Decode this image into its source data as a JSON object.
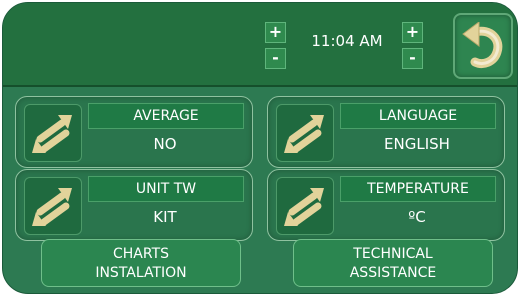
{
  "header": {
    "time": "11:04 AM",
    "hour_increase": "+",
    "hour_decrease": "-",
    "minute_increase": "+",
    "minute_decrease": "-"
  },
  "settings": [
    {
      "label": "AVERAGE",
      "value": "NO"
    },
    {
      "label": "LANGUAGE",
      "value": "ENGLISH"
    },
    {
      "label": "UNIT TW",
      "value": "KIT"
    },
    {
      "label": "TEMPERATURE",
      "value": "ºC"
    }
  ],
  "buttons": {
    "charts_line1": "CHARTS",
    "charts_line2": "INSTALATION",
    "tech_line1": "TECHNICAL",
    "tech_line2": "ASSISTANCE"
  },
  "icons": {
    "swap": "swap-arrows-icon",
    "back": "back-arrow-icon"
  },
  "colors": {
    "panel": "#2d7a52",
    "header": "#23703f",
    "accent": "#e2d39a"
  }
}
